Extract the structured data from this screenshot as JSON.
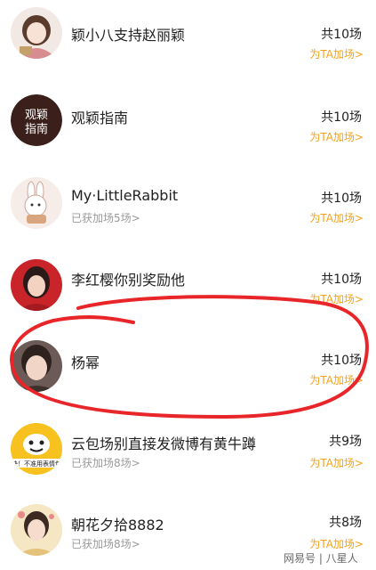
{
  "list": [
    {
      "name": "颖小八支持赵丽颖",
      "sub": "",
      "count": "共10场",
      "cta": "为TA加场>",
      "avatar": "drawn-girl-icon"
    },
    {
      "name": "观颖指南",
      "sub": "",
      "count": "共10场",
      "cta": "为TA加场>",
      "avatar": "calligraphy-logo-icon"
    },
    {
      "name": "My·LittleRabbit",
      "sub": "已获加场5场>",
      "count": "共10场",
      "cta": "为TA加场>",
      "avatar": "rabbit-cartoon-icon"
    },
    {
      "name": "李红樱你别奖励他",
      "sub": "",
      "count": "共10场",
      "cta": "为TA加场>",
      "avatar": "woman-portrait-icon"
    },
    {
      "name": "杨幂",
      "sub": "",
      "count": "共10场",
      "cta": "为TA加场>",
      "avatar": "woman-portrait-icon"
    },
    {
      "name": "云包场别直接发微博有黄牛蹲",
      "sub": "已获加场8场>",
      "count": "共9场",
      "cta": "为TA加场>",
      "avatar": "cartoon-face-icon"
    },
    {
      "name": "朝花夕拾8882",
      "sub": "已获加场8场>",
      "count": "共8场",
      "cta": "为TA加场>",
      "avatar": "woman-portrait-icon"
    }
  ],
  "logo_text": {
    "guanying": "观颖\n指南",
    "sticker": "快！不准用表情包"
  },
  "watermark": "网易号 | 八星人",
  "colors": {
    "accent": "#f4a21a",
    "annotation": "#e8262a",
    "sub_text": "#9a9a9a"
  }
}
